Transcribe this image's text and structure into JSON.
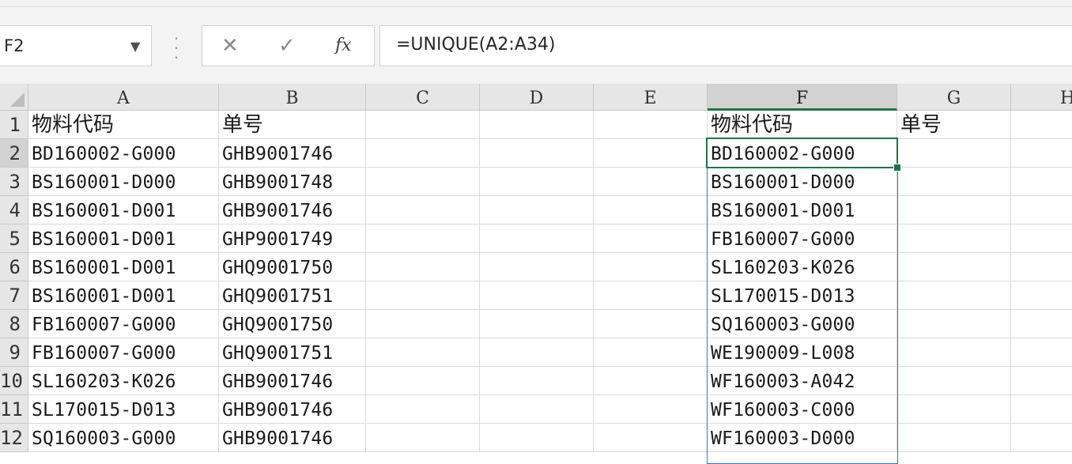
{
  "formula_bar": {
    "name_box": "F2",
    "cancel_glyph": "✕",
    "enter_glyph": "✓",
    "fx_label": "fx",
    "formula": "=UNIQUE(A2:A34)"
  },
  "grid": {
    "columns": [
      "A",
      "B",
      "C",
      "D",
      "E",
      "F",
      "G",
      "H"
    ],
    "active_column": "F",
    "active_cell": "F2",
    "spill_range": "F2:F34",
    "rows": [
      {
        "n": "1",
        "A": "物料代码",
        "B": "单号",
        "F": "物料代码",
        "G": "单号"
      },
      {
        "n": "2",
        "A": "BD160002-G000",
        "B": "GHB9001746",
        "F": "BD160002-G000"
      },
      {
        "n": "3",
        "A": "BS160001-D000",
        "B": "GHB9001748",
        "F": "BS160001-D000"
      },
      {
        "n": "4",
        "A": "BS160001-D001",
        "B": "GHB9001746",
        "F": "BS160001-D001"
      },
      {
        "n": "5",
        "A": "BS160001-D001",
        "B": "GHP9001749",
        "F": "FB160007-G000"
      },
      {
        "n": "6",
        "A": "BS160001-D001",
        "B": "GHQ9001750",
        "F": "SL160203-K026"
      },
      {
        "n": "7",
        "A": "BS160001-D001",
        "B": "GHQ9001751",
        "F": "SL170015-D013"
      },
      {
        "n": "8",
        "A": "FB160007-G000",
        "B": "GHQ9001750",
        "F": "SQ160003-G000"
      },
      {
        "n": "9",
        "A": "FB160007-G000",
        "B": "GHQ9001751",
        "F": "WE190009-L008"
      },
      {
        "n": "10",
        "A": "SL160203-K026",
        "B": "GHB9001746",
        "F": "WF160003-A042"
      },
      {
        "n": "11",
        "A": "SL170015-D013",
        "B": "GHB9001746",
        "F": "WF160003-C000"
      },
      {
        "n": "12",
        "A": "SQ160003-G000",
        "B": "GHB9001746",
        "F": "WF160003-D000"
      }
    ]
  }
}
